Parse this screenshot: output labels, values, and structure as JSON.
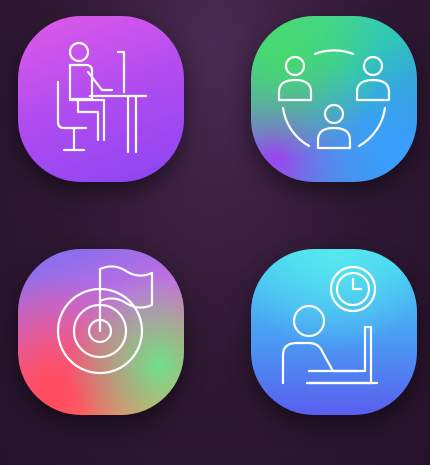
{
  "icons": [
    {
      "name": "remote-work-desk-icon",
      "gradient": [
        "#e05ae8",
        "#8a45f2"
      ]
    },
    {
      "name": "team-network-icon",
      "gradient": [
        "#54e07a",
        "#3f7cf0"
      ]
    },
    {
      "name": "goal-target-flag-icon",
      "gradient": [
        "#7a6ef0",
        "#ff6a70"
      ]
    },
    {
      "name": "working-hours-icon",
      "gradient": [
        "#4ad6f2",
        "#5a5ef0"
      ]
    }
  ],
  "line_color": "#ffffff"
}
